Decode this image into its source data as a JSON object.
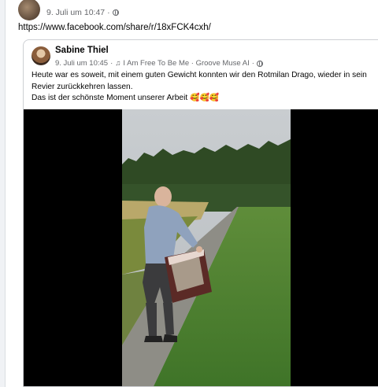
{
  "outer_post": {
    "timestamp": "9. Juli um 10:47",
    "separator": "·",
    "link_text": "https://www.facebook.com/share/r/18xFCK4cxh/"
  },
  "shared_post": {
    "author": "Sabine Thiel",
    "timestamp": "9. Juli um 10:45",
    "separator": "·",
    "music_note": "♫",
    "audio": "I Am Free To Be Me · Groove Muse AI",
    "text_line1": "Heute war es soweit, mit einem guten Gewicht konnten wir den Rotmilan Drago, wieder in sein Revier zurückkehren lassen.",
    "text_line2": "Das ist der schönste Moment unserer Arbeit",
    "emojis": "🥰🥰🥰"
  },
  "video": {
    "description_icon": "video-player"
  },
  "colors": {
    "background": "#f0f2f5",
    "card": "#ffffff",
    "meta_text": "#65676b",
    "border": "#ced0d4"
  }
}
